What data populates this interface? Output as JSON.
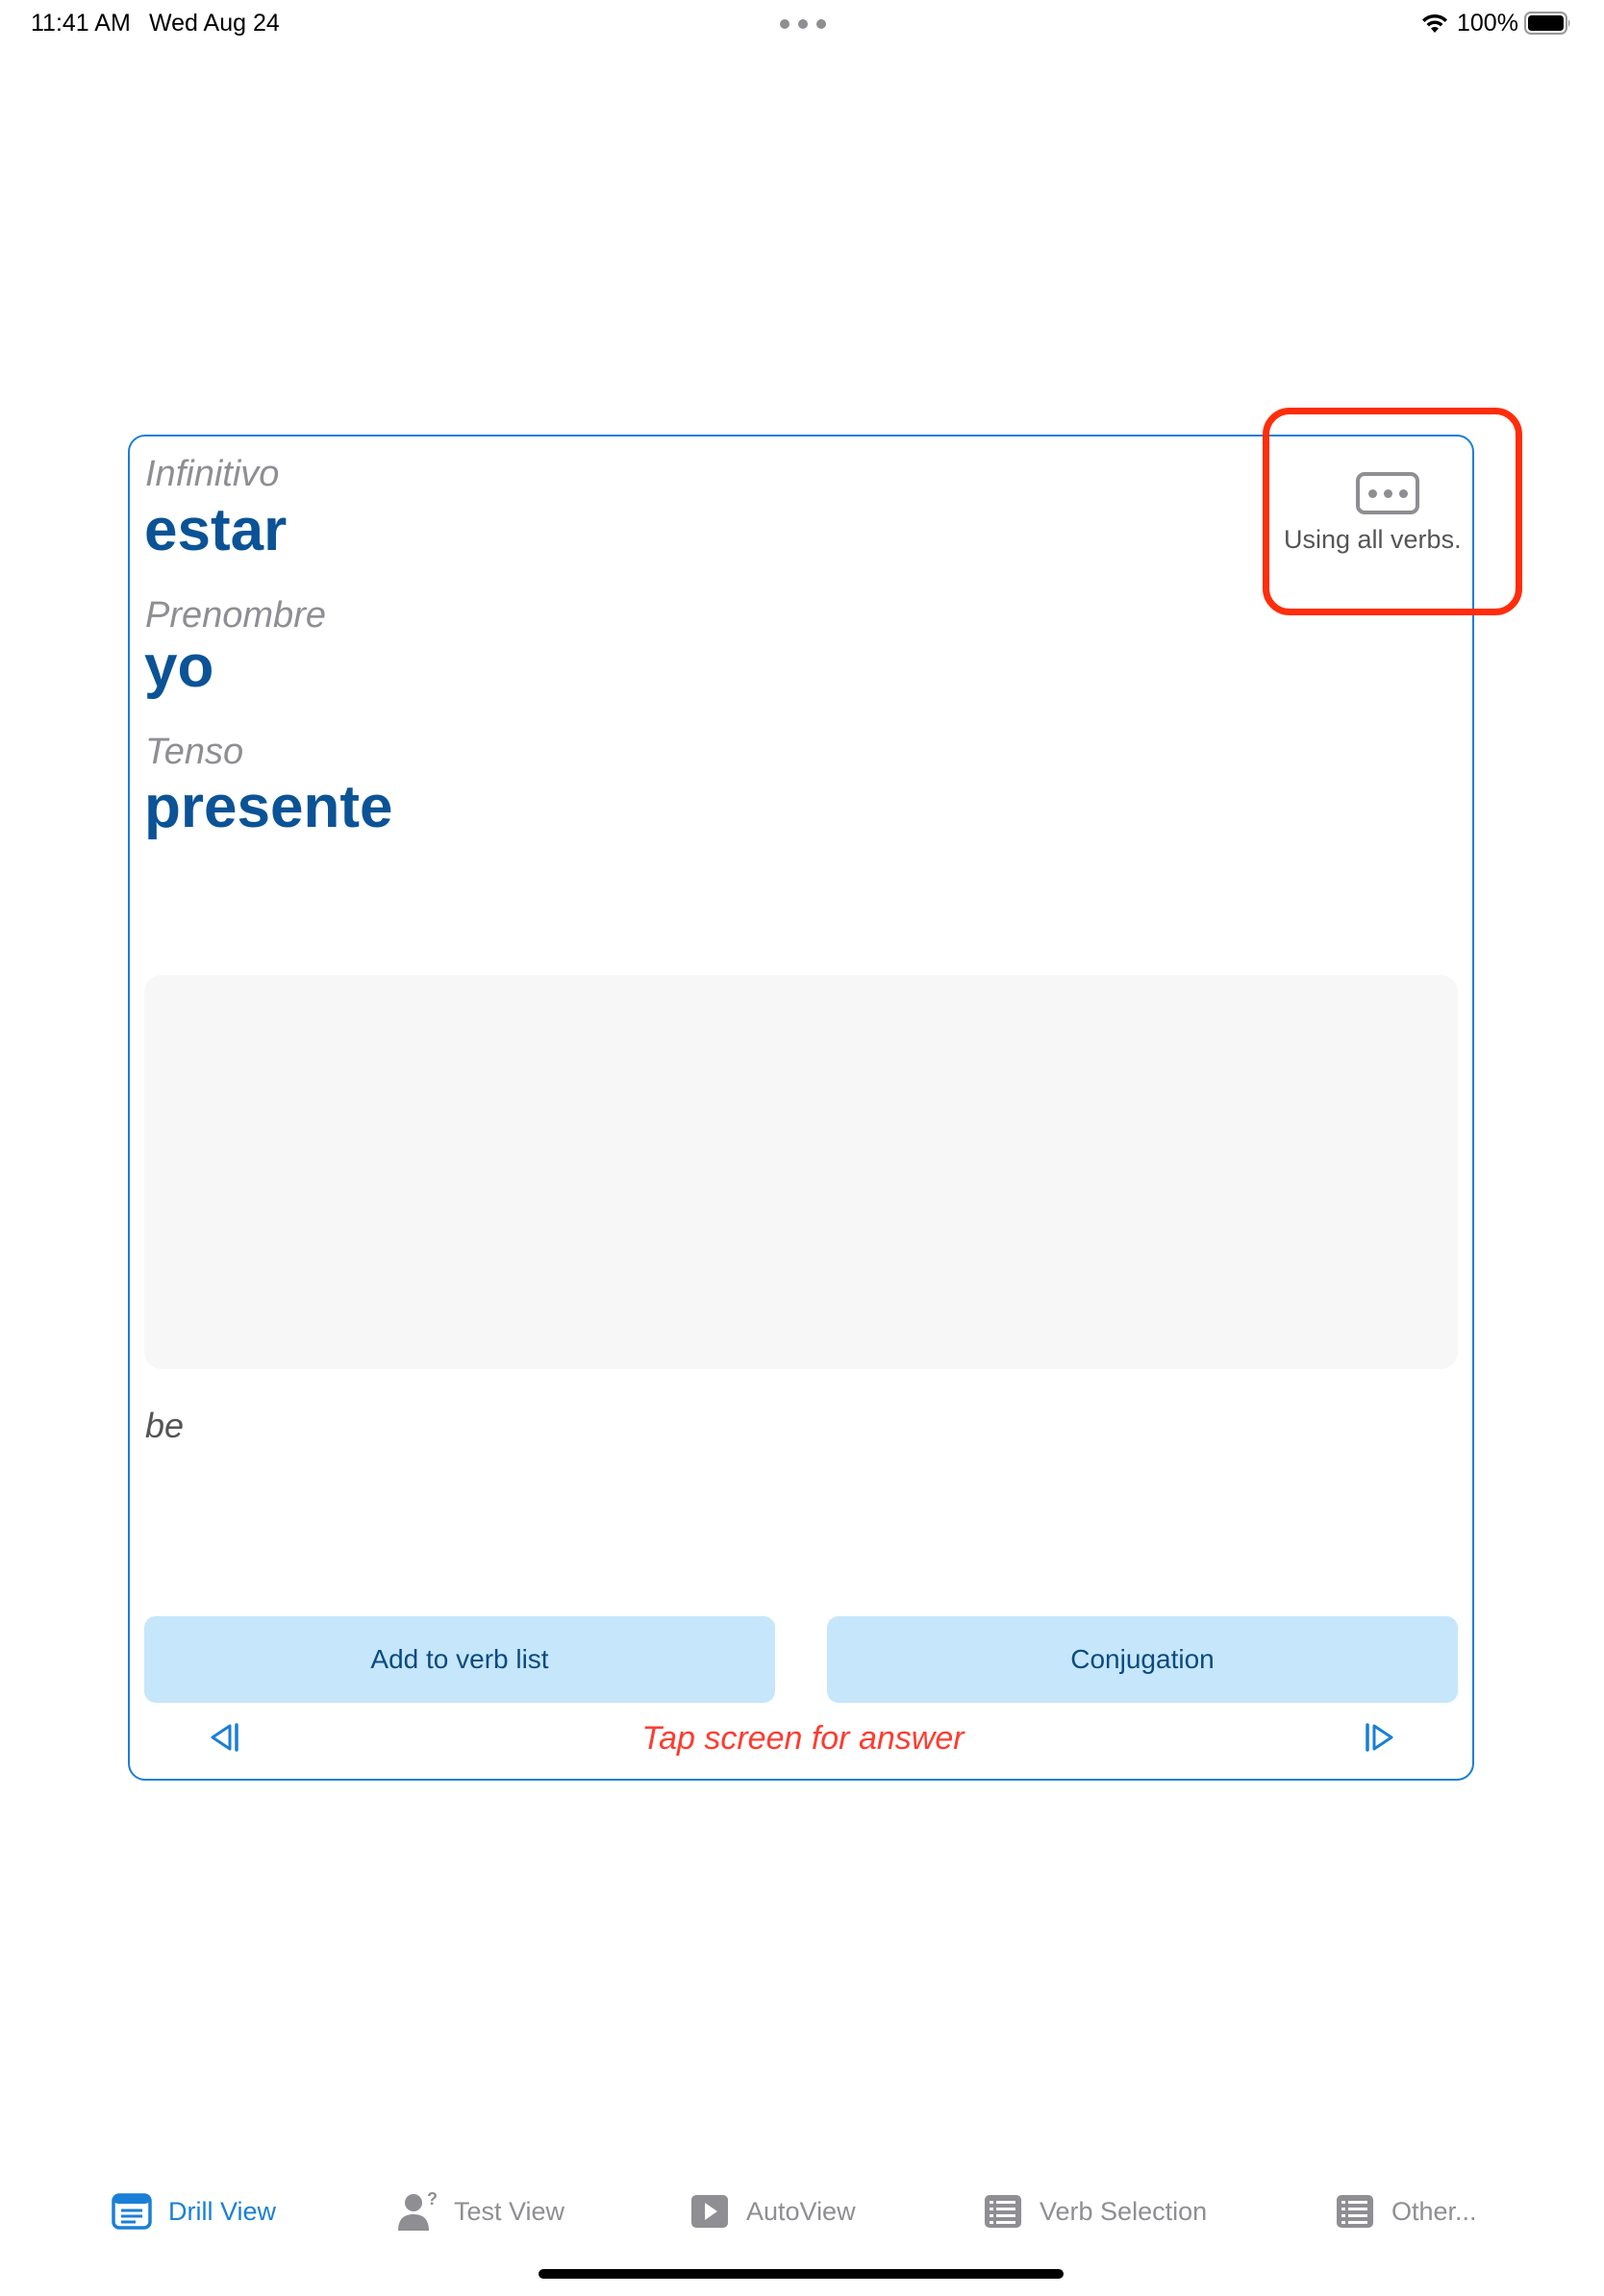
{
  "status_bar": {
    "time": "11:41 AM",
    "date": "Wed Aug 24",
    "battery_percent": "100%"
  },
  "card": {
    "infinitive_label": "Infinitivo",
    "infinitive_value": "estar",
    "pronoun_label": "Prenombre",
    "pronoun_value": "yo",
    "tense_label": "Tenso",
    "tense_value": "presente",
    "verb_filter_caption": "Using all verbs.",
    "meaning": "be",
    "add_button": "Add to verb list",
    "conjugation_button": "Conjugation",
    "tap_hint": "Tap screen for answer"
  },
  "colors": {
    "accent": "#1a7fd6",
    "value_text": "#0b5396",
    "button_bg": "#c6e6fb",
    "hint": "#ff3b30",
    "highlight": "#ff2d0a"
  },
  "tabs": [
    {
      "label": "Drill View",
      "icon": "drill-view-icon",
      "selected": true
    },
    {
      "label": "Test View",
      "icon": "test-view-icon",
      "selected": false
    },
    {
      "label": "AutoView",
      "icon": "autoview-icon",
      "selected": false
    },
    {
      "label": "Verb Selection",
      "icon": "verb-selection-icon",
      "selected": false
    },
    {
      "label": "Other...",
      "icon": "other-icon",
      "selected": false
    }
  ]
}
